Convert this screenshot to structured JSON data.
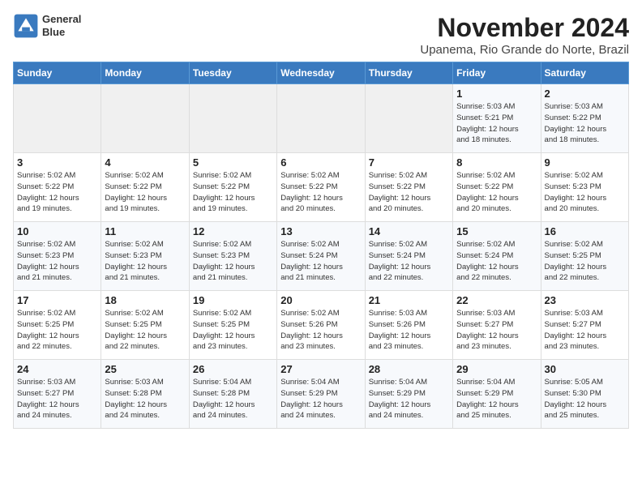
{
  "header": {
    "logo_line1": "General",
    "logo_line2": "Blue",
    "month": "November 2024",
    "location": "Upanema, Rio Grande do Norte, Brazil"
  },
  "weekdays": [
    "Sunday",
    "Monday",
    "Tuesday",
    "Wednesday",
    "Thursday",
    "Friday",
    "Saturday"
  ],
  "weeks": [
    [
      {
        "day": "",
        "info": ""
      },
      {
        "day": "",
        "info": ""
      },
      {
        "day": "",
        "info": ""
      },
      {
        "day": "",
        "info": ""
      },
      {
        "day": "",
        "info": ""
      },
      {
        "day": "1",
        "info": "Sunrise: 5:03 AM\nSunset: 5:21 PM\nDaylight: 12 hours\nand 18 minutes."
      },
      {
        "day": "2",
        "info": "Sunrise: 5:03 AM\nSunset: 5:22 PM\nDaylight: 12 hours\nand 18 minutes."
      }
    ],
    [
      {
        "day": "3",
        "info": "Sunrise: 5:02 AM\nSunset: 5:22 PM\nDaylight: 12 hours\nand 19 minutes."
      },
      {
        "day": "4",
        "info": "Sunrise: 5:02 AM\nSunset: 5:22 PM\nDaylight: 12 hours\nand 19 minutes."
      },
      {
        "day": "5",
        "info": "Sunrise: 5:02 AM\nSunset: 5:22 PM\nDaylight: 12 hours\nand 19 minutes."
      },
      {
        "day": "6",
        "info": "Sunrise: 5:02 AM\nSunset: 5:22 PM\nDaylight: 12 hours\nand 20 minutes."
      },
      {
        "day": "7",
        "info": "Sunrise: 5:02 AM\nSunset: 5:22 PM\nDaylight: 12 hours\nand 20 minutes."
      },
      {
        "day": "8",
        "info": "Sunrise: 5:02 AM\nSunset: 5:22 PM\nDaylight: 12 hours\nand 20 minutes."
      },
      {
        "day": "9",
        "info": "Sunrise: 5:02 AM\nSunset: 5:23 PM\nDaylight: 12 hours\nand 20 minutes."
      }
    ],
    [
      {
        "day": "10",
        "info": "Sunrise: 5:02 AM\nSunset: 5:23 PM\nDaylight: 12 hours\nand 21 minutes."
      },
      {
        "day": "11",
        "info": "Sunrise: 5:02 AM\nSunset: 5:23 PM\nDaylight: 12 hours\nand 21 minutes."
      },
      {
        "day": "12",
        "info": "Sunrise: 5:02 AM\nSunset: 5:23 PM\nDaylight: 12 hours\nand 21 minutes."
      },
      {
        "day": "13",
        "info": "Sunrise: 5:02 AM\nSunset: 5:24 PM\nDaylight: 12 hours\nand 21 minutes."
      },
      {
        "day": "14",
        "info": "Sunrise: 5:02 AM\nSunset: 5:24 PM\nDaylight: 12 hours\nand 22 minutes."
      },
      {
        "day": "15",
        "info": "Sunrise: 5:02 AM\nSunset: 5:24 PM\nDaylight: 12 hours\nand 22 minutes."
      },
      {
        "day": "16",
        "info": "Sunrise: 5:02 AM\nSunset: 5:25 PM\nDaylight: 12 hours\nand 22 minutes."
      }
    ],
    [
      {
        "day": "17",
        "info": "Sunrise: 5:02 AM\nSunset: 5:25 PM\nDaylight: 12 hours\nand 22 minutes."
      },
      {
        "day": "18",
        "info": "Sunrise: 5:02 AM\nSunset: 5:25 PM\nDaylight: 12 hours\nand 22 minutes."
      },
      {
        "day": "19",
        "info": "Sunrise: 5:02 AM\nSunset: 5:25 PM\nDaylight: 12 hours\nand 23 minutes."
      },
      {
        "day": "20",
        "info": "Sunrise: 5:02 AM\nSunset: 5:26 PM\nDaylight: 12 hours\nand 23 minutes."
      },
      {
        "day": "21",
        "info": "Sunrise: 5:03 AM\nSunset: 5:26 PM\nDaylight: 12 hours\nand 23 minutes."
      },
      {
        "day": "22",
        "info": "Sunrise: 5:03 AM\nSunset: 5:27 PM\nDaylight: 12 hours\nand 23 minutes."
      },
      {
        "day": "23",
        "info": "Sunrise: 5:03 AM\nSunset: 5:27 PM\nDaylight: 12 hours\nand 23 minutes."
      }
    ],
    [
      {
        "day": "24",
        "info": "Sunrise: 5:03 AM\nSunset: 5:27 PM\nDaylight: 12 hours\nand 24 minutes."
      },
      {
        "day": "25",
        "info": "Sunrise: 5:03 AM\nSunset: 5:28 PM\nDaylight: 12 hours\nand 24 minutes."
      },
      {
        "day": "26",
        "info": "Sunrise: 5:04 AM\nSunset: 5:28 PM\nDaylight: 12 hours\nand 24 minutes."
      },
      {
        "day": "27",
        "info": "Sunrise: 5:04 AM\nSunset: 5:29 PM\nDaylight: 12 hours\nand 24 minutes."
      },
      {
        "day": "28",
        "info": "Sunrise: 5:04 AM\nSunset: 5:29 PM\nDaylight: 12 hours\nand 24 minutes."
      },
      {
        "day": "29",
        "info": "Sunrise: 5:04 AM\nSunset: 5:29 PM\nDaylight: 12 hours\nand 25 minutes."
      },
      {
        "day": "30",
        "info": "Sunrise: 5:05 AM\nSunset: 5:30 PM\nDaylight: 12 hours\nand 25 minutes."
      }
    ]
  ]
}
